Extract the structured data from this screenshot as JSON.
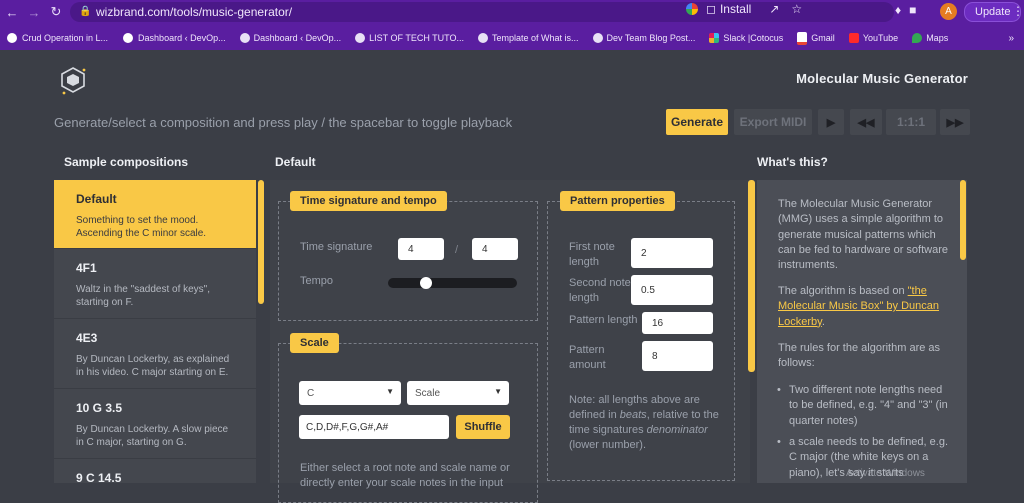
{
  "browser": {
    "url": "wizbrand.com/tools/music-generator/",
    "install_label": "Install",
    "avatar_letter": "A",
    "update_label": "Update",
    "bookmarks": [
      {
        "label": "Crud Operation in L...",
        "icon": "wordpress-icon"
      },
      {
        "label": "Dashboard ‹ DevOp...",
        "icon": "wordpress-icon"
      },
      {
        "label": "Dashboard ‹ DevOp...",
        "icon": "site-icon"
      },
      {
        "label": "LIST OF TECH TUTO...",
        "icon": "site-icon"
      },
      {
        "label": "Template of What is...",
        "icon": "site-icon"
      },
      {
        "label": "Dev Team Blog Post...",
        "icon": "site-icon"
      },
      {
        "label": "Slack |Cotocus",
        "icon": "slack-icon"
      },
      {
        "label": "Gmail",
        "icon": "gmail-icon"
      },
      {
        "label": "YouTube",
        "icon": "youtube-icon"
      },
      {
        "label": "Maps",
        "icon": "maps-icon"
      }
    ]
  },
  "header": {
    "title": "Molecular Music Generator",
    "instructions": "Generate/select a composition and press play / the spacebar to toggle playback",
    "generate_label": "Generate",
    "export_label": "Export MIDI",
    "play_glyph": "▶",
    "rewind_glyph": "◀◀",
    "ratio_label": "1:1:1",
    "ffwd_glyph": "▶▶"
  },
  "columns": {
    "left": "Sample compositions",
    "middle": "Default",
    "right": "What's this?"
  },
  "compositions": [
    {
      "name": "Default",
      "desc": "Something to set the mood. Ascending the C minor scale."
    },
    {
      "name": "4F1",
      "desc": "Waltz in the \"saddest of keys\", starting on F."
    },
    {
      "name": "4E3",
      "desc": "By Duncan Lockerby, as explained in his video. C major starting on E."
    },
    {
      "name": "10 G 3.5",
      "desc": "By Duncan Lockerby. A slow piece in C major, starting on G."
    },
    {
      "name": "9 C 14.5",
      "desc": ""
    }
  ],
  "time_tempo": {
    "legend": "Time signature and tempo",
    "time_sig_label": "Time signature",
    "numerator": "4",
    "denominator": "4",
    "slash": "/",
    "tempo_label": "Tempo",
    "tempo_level": 0.27
  },
  "scale": {
    "legend": "Scale",
    "root_value": "C",
    "scale_value": "Scale",
    "notes": "C,D,D#,F,G,G#,A#",
    "shuffle_label": "Shuffle",
    "help": "Either select a root note and scale name or directly enter your scale notes in the input"
  },
  "pattern": {
    "legend": "Pattern properties",
    "first_label": "First note length",
    "first_value": "2",
    "second_label": "Second note length",
    "second_value": "0.5",
    "pattern_label": "Pattern length",
    "pattern_value": "16",
    "amount_label": "Pattern amount",
    "amount_value": "8",
    "note_pre": "Note: all lengths above are defined in ",
    "note_beats": "beats",
    "note_mid": ", relative to the time signatures ",
    "note_denom": "denominator",
    "note_post": " (lower number)."
  },
  "about": {
    "p1": "The Molecular Music Generator (MMG) uses a simple algorithm to generate musical patterns which can be fed to hardware or software instruments.",
    "p2_pre": "The algorithm is based on ",
    "p2_link": "\"the Molecular Music Box\" by Duncan Lockerby",
    "p2_post": ".",
    "p3": "The rules for the algorithm are as follows:",
    "b1": "Two different note lengths need to be defined, e.g. \"4\" and \"3\" (in quarter notes)",
    "b2": "a scale needs to be defined, e.g. C major (the white keys on a piano), let's say it starts",
    "watermark": "Activate Windows"
  }
}
